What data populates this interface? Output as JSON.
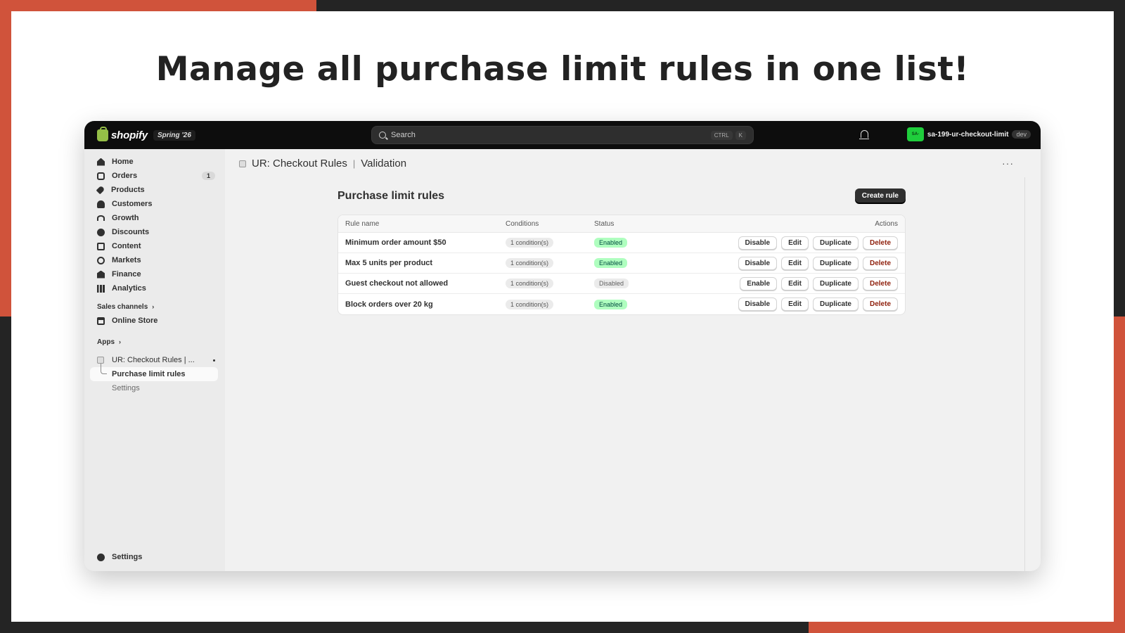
{
  "headline": "Manage all purchase limit rules in one list!",
  "colors": {
    "accent": "#d0533b",
    "frame": "#242424",
    "topbar": "#0d0d0d",
    "primary_button": "#303030",
    "enabled_badge": "#affebf",
    "delete_text": "#8e1f0b"
  },
  "topbar": {
    "logo": "shopify",
    "edition": "Spring '26",
    "search_placeholder": "Search",
    "shortcut": [
      "CTRL",
      "K"
    ],
    "store_avatar": "SA-",
    "store_name": "sa-199-ur-checkout-limit",
    "store_badge": "dev"
  },
  "sidebar": {
    "items": [
      {
        "label": "Home",
        "icon": "home-icon"
      },
      {
        "label": "Orders",
        "icon": "orders-icon",
        "count": "1"
      },
      {
        "label": "Products",
        "icon": "tag-icon"
      },
      {
        "label": "Customers",
        "icon": "person-icon"
      },
      {
        "label": "Growth",
        "icon": "gauge-icon"
      },
      {
        "label": "Discounts",
        "icon": "discount-icon"
      },
      {
        "label": "Content",
        "icon": "content-icon"
      },
      {
        "label": "Markets",
        "icon": "globe-icon"
      },
      {
        "label": "Finance",
        "icon": "bank-icon"
      },
      {
        "label": "Analytics",
        "icon": "bar-chart-icon"
      }
    ],
    "sales_channels_label": "Sales channels",
    "sales_channels": [
      {
        "label": "Online Store",
        "icon": "store-icon"
      }
    ],
    "apps_label": "Apps",
    "app": {
      "label": "UR: Checkout Rules | ...",
      "sub_items": [
        "Purchase limit rules",
        "Settings"
      ]
    },
    "settings_label": "Settings"
  },
  "main": {
    "app_title": "UR: Checkout Rules",
    "app_subtitle": "Validation",
    "page_title": "Purchase limit rules",
    "create_button": "Create rule",
    "columns": [
      "Rule name",
      "Conditions",
      "Status",
      "Actions"
    ],
    "rules": [
      {
        "name": "Minimum order amount $50",
        "conditions": "1 condition(s)",
        "status": "Enabled",
        "toggle": "Disable"
      },
      {
        "name": "Max 5 units per product",
        "conditions": "1 condition(s)",
        "status": "Enabled",
        "toggle": "Disable"
      },
      {
        "name": "Guest checkout not allowed",
        "conditions": "1 condition(s)",
        "status": "Disabled",
        "toggle": "Enable"
      },
      {
        "name": "Block orders over 20 kg",
        "conditions": "1 condition(s)",
        "status": "Enabled",
        "toggle": "Disable"
      }
    ],
    "row_actions": {
      "edit": "Edit",
      "duplicate": "Duplicate",
      "delete": "Delete"
    }
  }
}
